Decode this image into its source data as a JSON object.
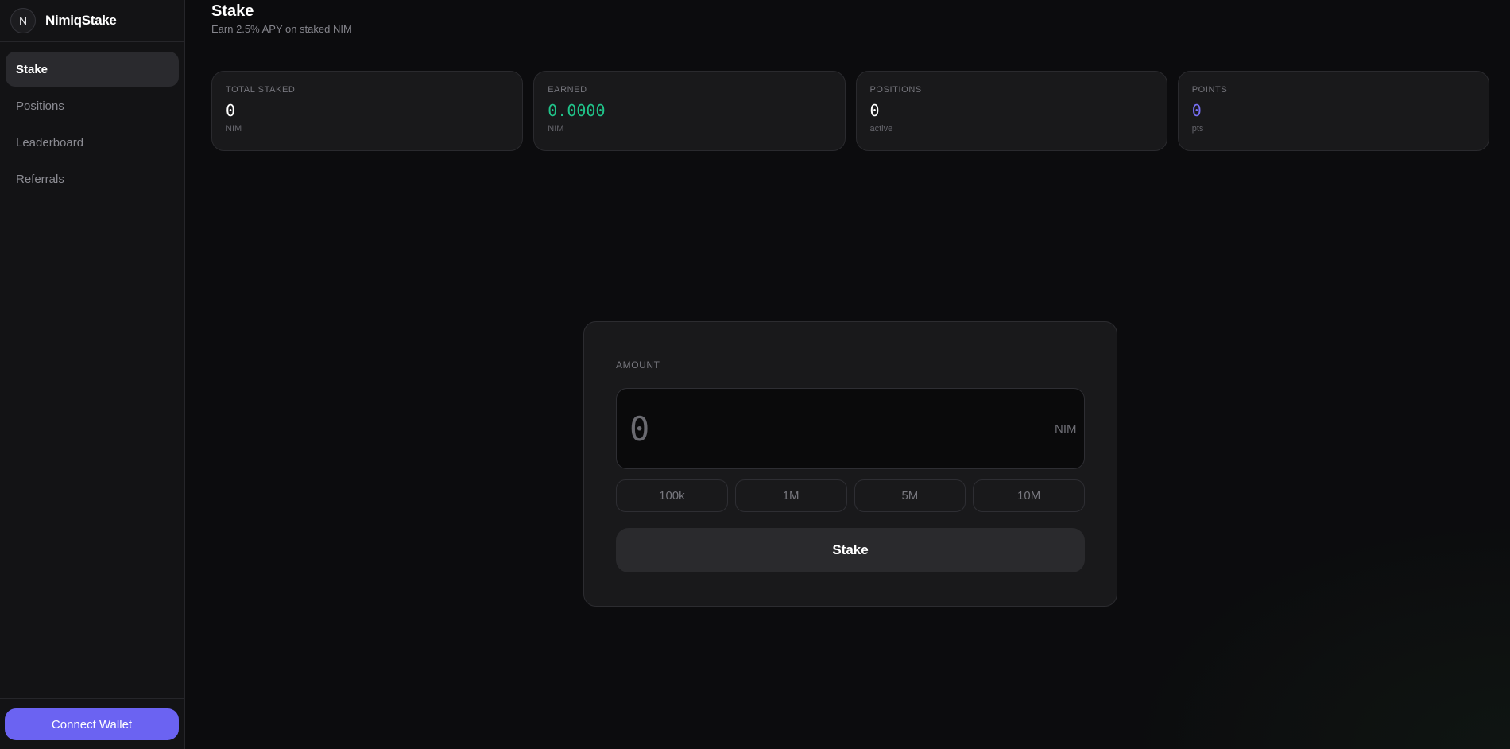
{
  "brand": {
    "logo_letter": "N",
    "name": "NimiqStake"
  },
  "sidebar": {
    "items": [
      {
        "label": "Stake",
        "active": true
      },
      {
        "label": "Positions",
        "active": false
      },
      {
        "label": "Leaderboard",
        "active": false
      },
      {
        "label": "Referrals",
        "active": false
      }
    ],
    "connect_label": "Connect Wallet"
  },
  "header": {
    "title": "Stake",
    "subtitle": "Earn 2.5% APY on staked NIM"
  },
  "stats": [
    {
      "label": "TOTAL STAKED",
      "value": "0",
      "unit": "NIM"
    },
    {
      "label": "EARNED",
      "value": "0.0000",
      "unit": "NIM"
    },
    {
      "label": "POSITIONS",
      "value": "0",
      "unit": "active"
    },
    {
      "label": "POINTS",
      "value": "0",
      "unit": "pts"
    }
  ],
  "stake_form": {
    "amount_label": "AMOUNT",
    "amount_placeholder": "0",
    "amount_value": "",
    "unit": "NIM",
    "presets": [
      "100k",
      "1M",
      "5M",
      "10M"
    ],
    "submit_label": "Stake"
  },
  "colors": {
    "accent": "#6b63f2",
    "earned_green": "#20c48a",
    "points_purple": "#7870f5",
    "background": "#0c0c0e"
  }
}
